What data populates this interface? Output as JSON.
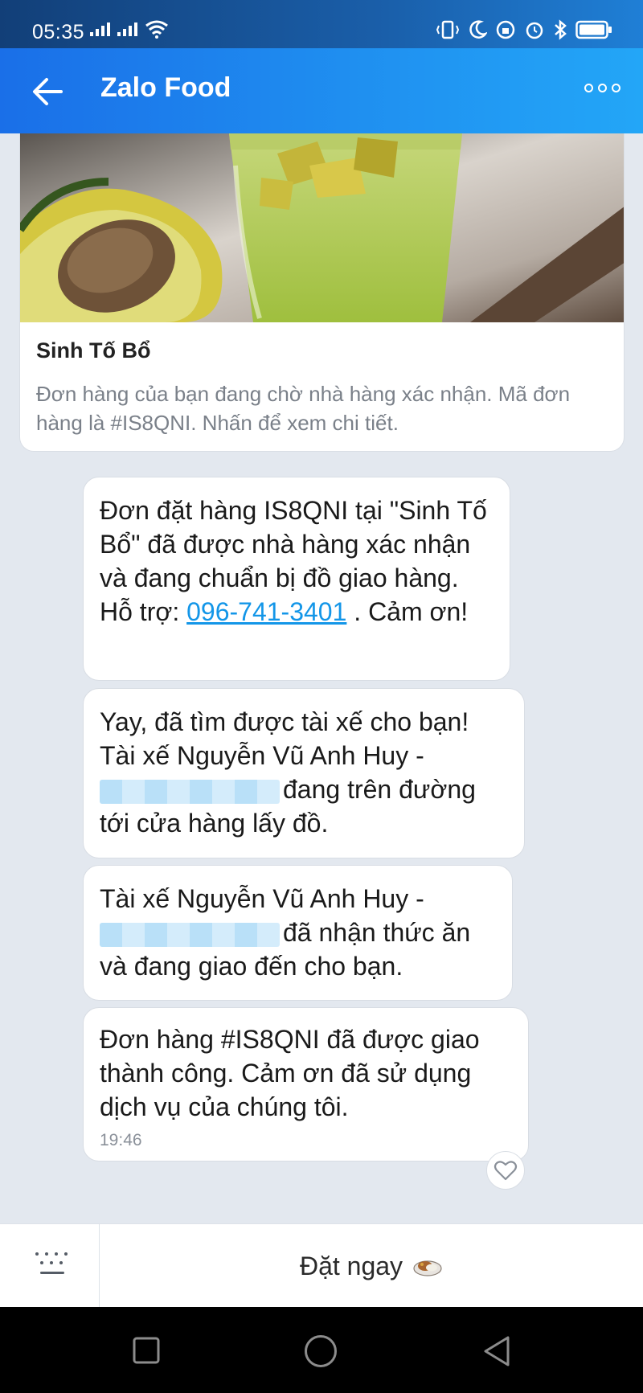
{
  "status_bar": {
    "time": "05:35"
  },
  "header": {
    "title": "Zalo Food"
  },
  "card": {
    "restaurant_name": "Sinh Tố Bổ",
    "description": "Đơn hàng của bạn đang chờ nhà hàng xác nhận. Mã đơn hàng là #IS8QNI. Nhấn để xem chi tiết."
  },
  "messages": [
    {
      "text_before": "Đơn đặt hàng IS8QNI tại \"Sinh Tố Bổ\" đã được nhà hàng xác nhận và đang chuẩn bị đồ giao hàng. Hỗ trợ: ",
      "phone": "096-741-3401",
      "text_after": " . Cảm ơn!"
    },
    {
      "text_before": "Yay, đã tìm được tài xế cho bạn! Tài xế Nguyễn Vũ Anh Huy - ",
      "text_after": "đang trên đường tới cửa hàng lấy đồ."
    },
    {
      "text_before": "Tài xế Nguyễn Vũ Anh Huy - ",
      "text_after": "đã nhận thức ăn và đang giao đến cho bạn."
    },
    {
      "text": "Đơn hàng #IS8QNI đã được giao thành công. Cảm ơn đã sử dụng dịch vụ của chúng tôi.",
      "time": "19:46"
    }
  ],
  "action_bar": {
    "order_label": "Đặt ngay"
  },
  "colors": {
    "header": "#1f8ff0",
    "link": "#1396e8",
    "background": "#e3e8ef"
  }
}
